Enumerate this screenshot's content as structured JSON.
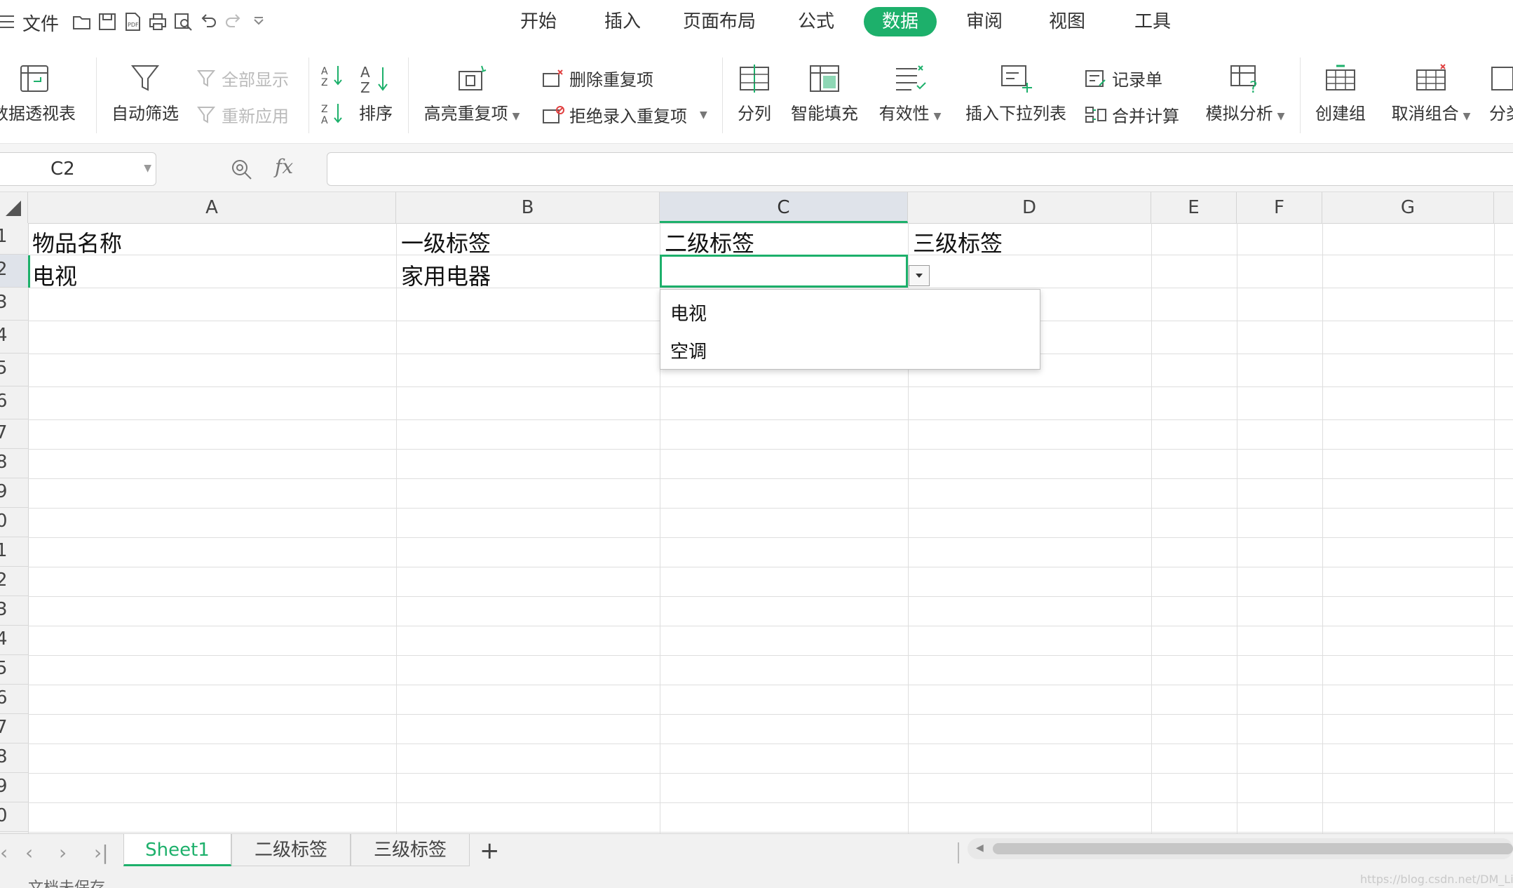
{
  "menubar": {
    "file_label": "文件",
    "tabs": [
      "开始",
      "插入",
      "页面布局",
      "公式",
      "数据",
      "审阅",
      "视图",
      "工具"
    ],
    "active_tab": "数据"
  },
  "ribbon": {
    "pivot_label": "数据透视表",
    "autofilter_label": "自动筛选",
    "show_all_label": "全部显示",
    "reapply_label": "重新应用",
    "sort_label": "排序",
    "highlight_dup_label": "高亮重复项",
    "remove_dup_label": "删除重复项",
    "reject_dup_label": "拒绝录入重复项",
    "split_label": "分列",
    "smart_fill_label": "智能填充",
    "validity_label": "有效性",
    "insert_dropdown_label": "插入下拉列表",
    "record_form_label": "记录单",
    "consolidate_label": "合并计算",
    "whatif_label": "模拟分析",
    "group_label": "创建组",
    "ungroup_label": "取消组合",
    "subtotal_label": "分类"
  },
  "formulabar": {
    "name_box": "C2",
    "fx_label": "fx",
    "formula_value": ""
  },
  "sheet": {
    "columns": [
      "A",
      "B",
      "C",
      "D",
      "E",
      "F",
      "G"
    ],
    "rows": [
      "1",
      "2",
      "3",
      "4",
      "5",
      "6",
      "7",
      "8",
      "9",
      "0",
      "1",
      "2",
      "3",
      "4",
      "5",
      "6",
      "7",
      "8",
      "9",
      "0"
    ],
    "cells": {
      "A1": "物品名称",
      "B1": "一级标签",
      "C1": "二级标签",
      "D1": "三级标签",
      "A2": "电视",
      "B2": "家用电器",
      "C2": ""
    },
    "dropdown_options": [
      "电视",
      "空调"
    ]
  },
  "sheet_tabs": {
    "tabs": [
      "Sheet1",
      "二级标签",
      "三级标签"
    ],
    "active": "Sheet1",
    "add_label": "+"
  },
  "statusbar": {
    "status_text": "文档未保存",
    "watermark": "https://blog.csdn.net/DM_Lin"
  },
  "colors": {
    "accent": "#1db06b",
    "header_bg": "#f1f1f1"
  }
}
